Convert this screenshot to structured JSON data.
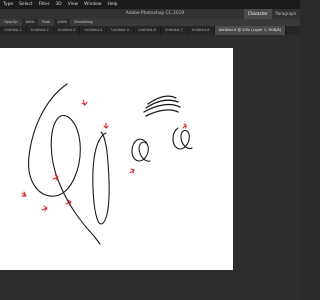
{
  "menubar": {
    "items": [
      "Type",
      "Select",
      "Filter",
      "3D",
      "View",
      "Window",
      "Help"
    ]
  },
  "titlebar": {
    "title": "Adobe Photoshop CC 2019"
  },
  "panel_tabs": [
    "Character",
    "Paragraph"
  ],
  "options": {
    "opacity_label": "Opacity:",
    "opacity_value": "100%",
    "flow_label": "Flow:",
    "flow_value": "100%",
    "smoothing_label": "Smoothing:"
  },
  "document_tabs": [
    "Untitled-1",
    "Untitled-2",
    "Untitled-3",
    "Untitled-4",
    "Untitled-5",
    "Untitled-6",
    "Untitled-7",
    "Untitled-8",
    "Untitled-9 @ 33% (Layer 1, RGB/8)"
  ],
  "active_document_index": 8,
  "colors": {
    "stroke": "#1a1a1a",
    "marker": "#d81b1b",
    "canvas": "#ffffff",
    "workspace": "#2d2d2d"
  }
}
